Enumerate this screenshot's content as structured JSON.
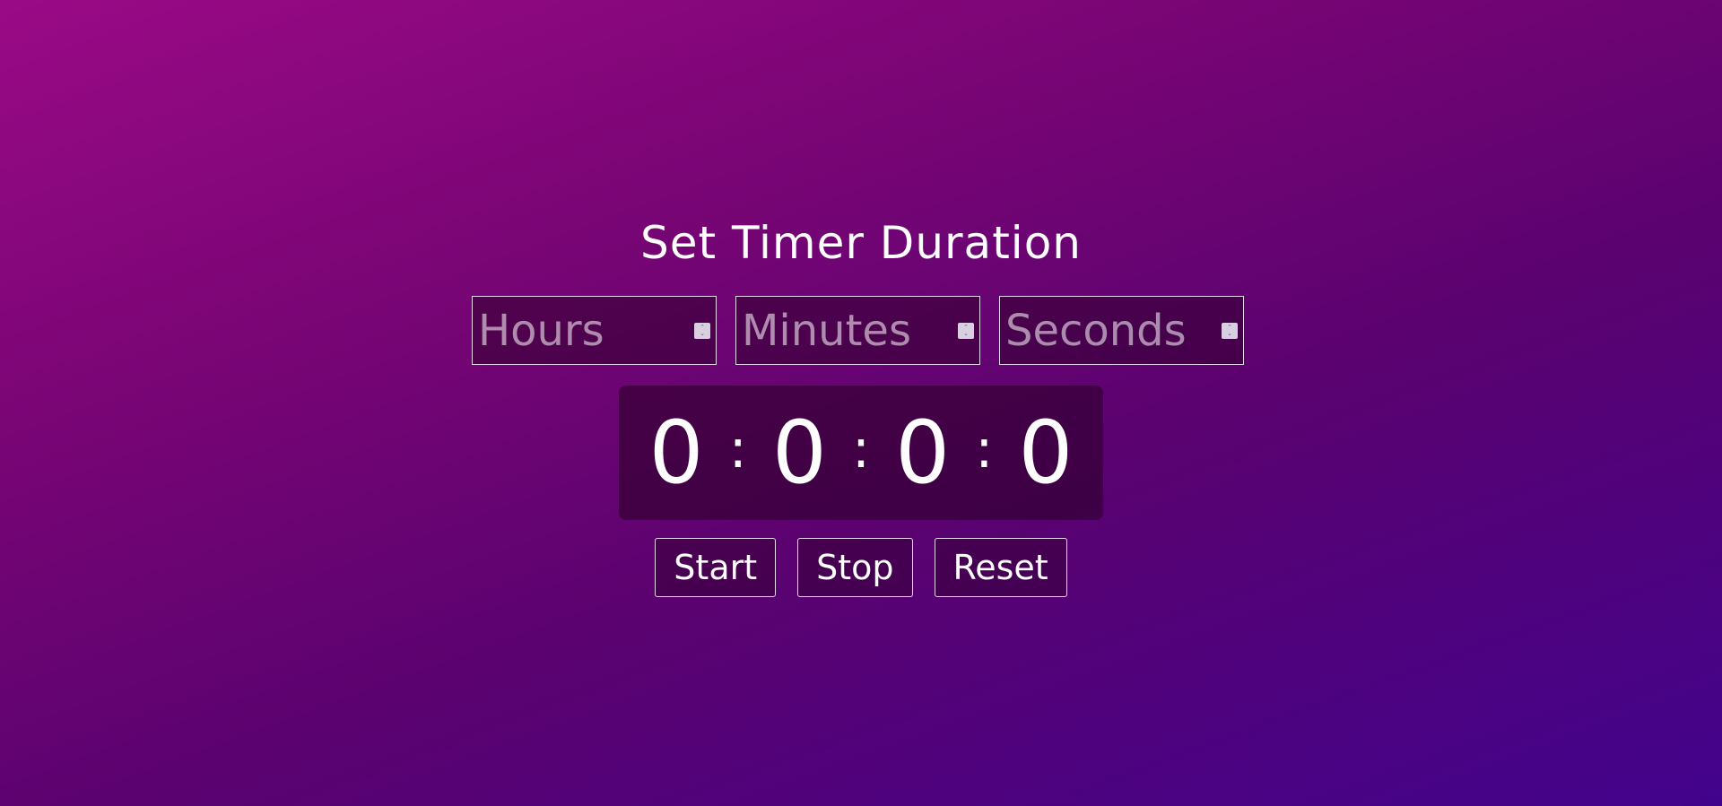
{
  "title": "Set Timer Duration",
  "inputs": {
    "hours": {
      "placeholder": "Hours",
      "value": ""
    },
    "minutes": {
      "placeholder": "Minutes",
      "value": ""
    },
    "seconds": {
      "placeholder": "Seconds",
      "value": ""
    }
  },
  "display": {
    "hours": "0",
    "minutes": "0",
    "seconds": "0",
    "milliseconds": "0",
    "separator": ":"
  },
  "buttons": {
    "start": "Start",
    "stop": "Stop",
    "reset": "Reset"
  },
  "icons": {
    "spinner": "spinner-up-down-icon"
  },
  "colors": {
    "background_start": "#9a0a86",
    "background_end": "#42038c",
    "text": "#ffffff"
  }
}
